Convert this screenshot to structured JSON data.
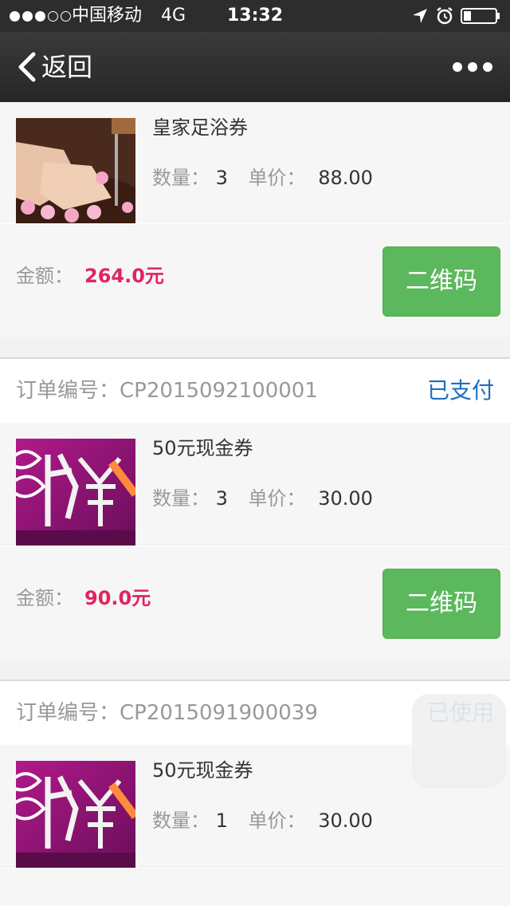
{
  "status_bar": {
    "carrier": "中国移动",
    "network": "4G",
    "time": "13:32"
  },
  "nav": {
    "back_label": "返回"
  },
  "labels": {
    "order_no": "订单编号：",
    "quantity": "数量：",
    "unit_price": "单价：",
    "amount": "金额：",
    "qr_button": "二维码"
  },
  "orders": [
    {
      "order_no": "",
      "status": "",
      "item": {
        "name": "皇家足浴券",
        "quantity": "3",
        "unit_price": "88.00",
        "image": "foot-bath-photo"
      },
      "amount": "264.0元"
    },
    {
      "order_no": "CP2015092100001",
      "status": "已支付",
      "item": {
        "name": "50元现金券",
        "quantity": "3",
        "unit_price": "30.00",
        "image": "cash-voucher-photo"
      },
      "amount": "90.0元"
    },
    {
      "order_no": "CP2015091900039",
      "status": "已使用",
      "item": {
        "name": "50元现金券",
        "quantity": "1",
        "unit_price": "30.00",
        "image": "cash-voucher-photo"
      }
    }
  ],
  "colors": {
    "status_link": "#1d6fc4",
    "amount": "#e0245e",
    "qr_button": "#5cb85c"
  }
}
